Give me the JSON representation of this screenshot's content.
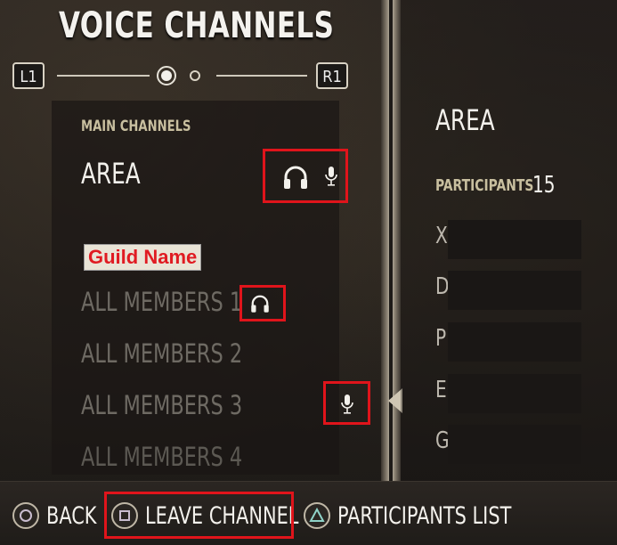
{
  "header": {
    "title": "VOICE CHANNELS",
    "left_bumper": "L1",
    "right_bumper": "R1"
  },
  "channels": {
    "section_label": "MAIN CHANNELS",
    "area": {
      "name": "AREA",
      "icons": [
        "headphones-icon",
        "microphone-icon"
      ]
    },
    "guild_name": "Guild Name",
    "members": [
      {
        "name": "ALL MEMBERS 1",
        "icon": "headphones-icon"
      },
      {
        "name": "ALL MEMBERS 2"
      },
      {
        "name": "ALL MEMBERS 3",
        "icon": "microphone-icon"
      },
      {
        "name": "ALL MEMBERS 4"
      }
    ]
  },
  "detail": {
    "title": "AREA",
    "participants_label": "PARTICIPANTS",
    "participants_count": "15",
    "participants": [
      "X",
      "D",
      "P",
      "E",
      "G"
    ]
  },
  "footer": {
    "back": "BACK",
    "leave": "LEAVE CHANNEL",
    "participants_list": "PARTICIPANTS LIST"
  },
  "colors": {
    "highlight": "#e0141b",
    "guild_name_text": "#e01b22",
    "section_label": "#c8bf9f"
  }
}
